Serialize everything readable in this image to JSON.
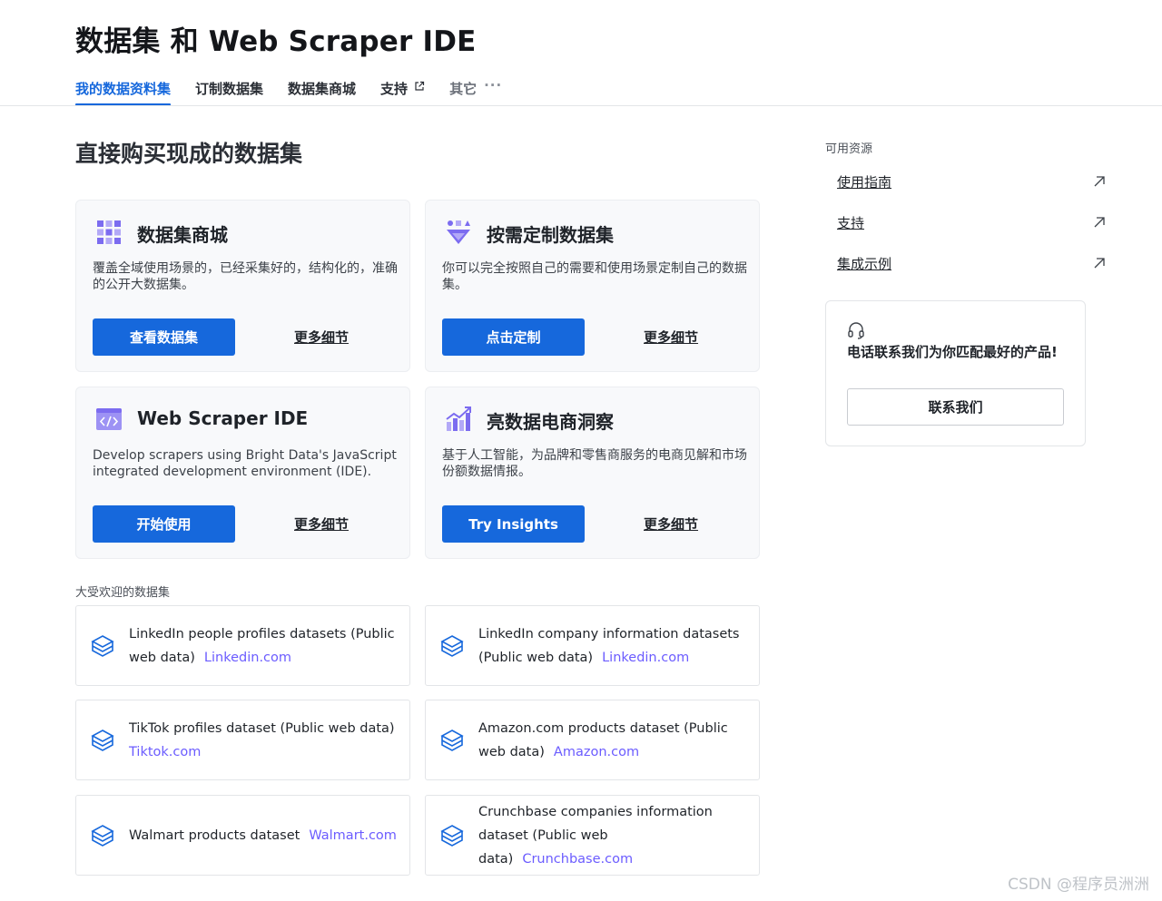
{
  "header": {
    "title": "数据集 和 Web Scraper IDE",
    "tabs": [
      {
        "label": "我的数据资料集",
        "active": true
      },
      {
        "label": "订制数据集"
      },
      {
        "label": "数据集商城"
      },
      {
        "label": "支持",
        "external": true
      },
      {
        "label": "其它",
        "more": true
      }
    ]
  },
  "main": {
    "section_title": "直接购买现成的数据集",
    "cards": [
      {
        "title": "数据集商城",
        "description": "覆盖全域使用场景的，已经采集好的，结构化的，准确的公开大数据集。",
        "button": "查看数据集",
        "link": "更多细节",
        "icon": "grid-icon"
      },
      {
        "title": "按需定制数据集",
        "description": "你可以完全按照自己的需要和使用场景定制自己的数据集。",
        "button": "点击定制",
        "link": "更多细节",
        "icon": "funnel-icon"
      },
      {
        "title": "Web Scraper IDE",
        "description": "Develop scrapers using Bright Data's JavaScript integrated development environment (IDE).",
        "button": "开始使用",
        "link": "更多细节",
        "icon": "code-window-icon"
      },
      {
        "title": "亮数据电商洞察",
        "description": "基于人工智能，为品牌和零售商服务的电商见解和市场份额数据情报。",
        "button": "Try Insights",
        "link": "更多细节",
        "icon": "chart-growth-icon"
      }
    ],
    "popular_label": "大受欢迎的数据集",
    "datasets": [
      {
        "name": "LinkedIn people profiles datasets (Public web data)",
        "domain": "Linkedin.com"
      },
      {
        "name": "LinkedIn company information datasets (Public web data)",
        "domain": "Linkedin.com"
      },
      {
        "name": "TikTok profiles dataset (Public web data)",
        "domain": "Tiktok.com"
      },
      {
        "name": "Amazon.com products dataset (Public web data)",
        "domain": "Amazon.com"
      },
      {
        "name": "Walmart products dataset",
        "domain": "Walmart.com"
      },
      {
        "name": "Crunchbase companies information dataset (Public web data)",
        "domain": "Crunchbase.com"
      }
    ]
  },
  "sidebar": {
    "label": "可用资源",
    "resources": [
      {
        "label": "使用指南"
      },
      {
        "label": "支持"
      },
      {
        "label": "集成示例"
      }
    ],
    "contact": {
      "text": "电话联系我们为你匹配最好的产品!",
      "button": "联系我们"
    }
  },
  "watermark": "CSDN @程序员洲洲",
  "colors": {
    "primary": "#1668dc",
    "link_purple": "#6b5cff",
    "icon_purple": "#7c6cf0"
  }
}
